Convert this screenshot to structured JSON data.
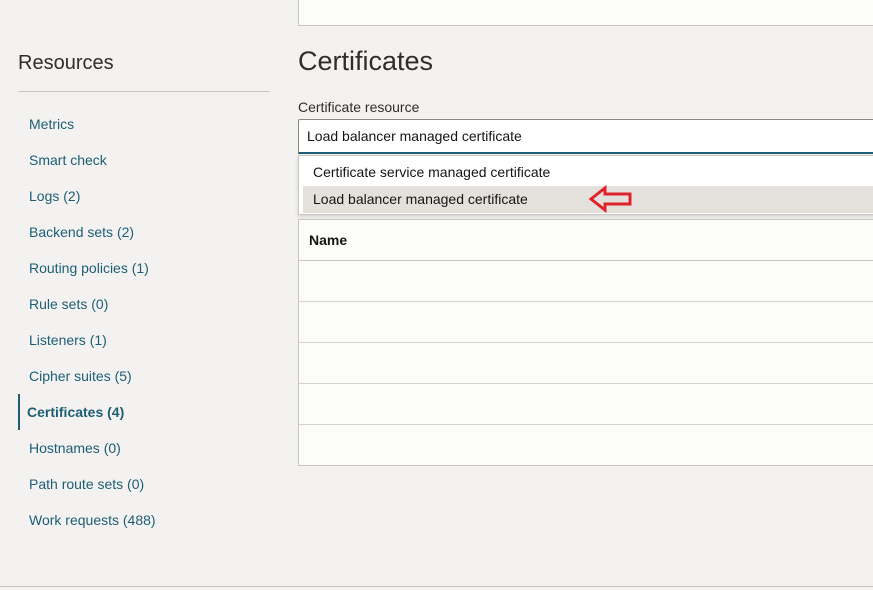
{
  "sidebar": {
    "title": "Resources",
    "items": [
      {
        "label": "Metrics"
      },
      {
        "label": "Smart check"
      },
      {
        "label": "Logs (2)"
      },
      {
        "label": "Backend sets (2)"
      },
      {
        "label": "Routing policies (1)"
      },
      {
        "label": "Rule sets (0)"
      },
      {
        "label": "Listeners (1)"
      },
      {
        "label": "Cipher suites (5)"
      },
      {
        "label": "Certificates (4)"
      },
      {
        "label": "Hostnames (0)"
      },
      {
        "label": "Path route sets (0)"
      },
      {
        "label": "Work requests (488)"
      }
    ],
    "active_index": 8
  },
  "main": {
    "title": "Certificates",
    "certificate_resource": {
      "label": "Certificate resource",
      "value": "Load balancer managed certificate",
      "options": [
        {
          "label": "Certificate service managed certificate"
        },
        {
          "label": "Load balancer managed certificate"
        }
      ]
    },
    "table": {
      "columns": [
        "Name"
      ]
    }
  },
  "annotation": {
    "arrow_icon": "left-arrow-icon",
    "color": "#e0222a"
  },
  "colors": {
    "link": "#1d5e74",
    "background": "#f3f2f0"
  }
}
